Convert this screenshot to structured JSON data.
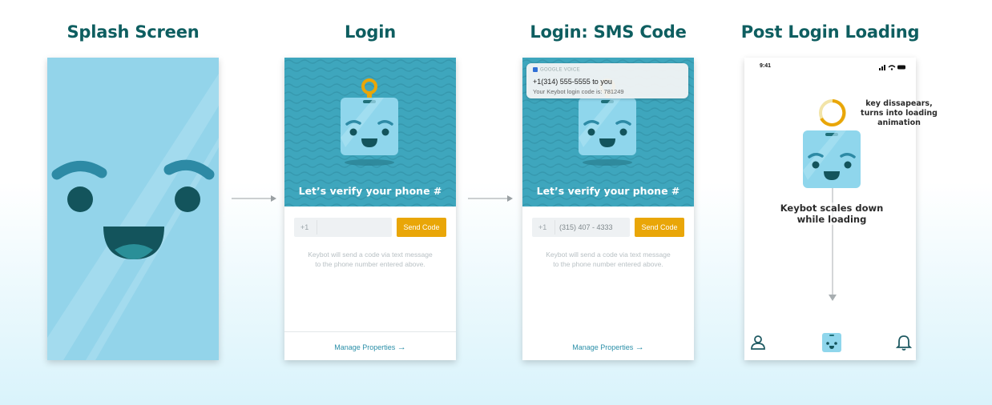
{
  "columns": {
    "splash": "Splash Screen",
    "login": "Login",
    "sms": "Login: SMS Code",
    "post": "Post Login Loading"
  },
  "login": {
    "hero_title": "Let’s verify your phone #",
    "country_code": "+1",
    "phone_value": "",
    "send_label": "Send Code",
    "hint_line1": "Keybot will send a code via text message",
    "hint_line2": "to the phone number entered above.",
    "manage_label": "Manage Properties"
  },
  "sms": {
    "hero_title": "Let’s verify your phone #",
    "country_code": "+1",
    "phone_value": "(315) 407 - 4333",
    "send_label": "Send Code",
    "hint_line1": "Keybot will send a code via text message",
    "hint_line2": "to the phone number entered above.",
    "manage_label": "Manage Properties",
    "notification": {
      "app": "GOOGLE VOICE",
      "from": "+1(314) 555-5555 to you",
      "message": "Your Keybot login code is: 781249"
    }
  },
  "post": {
    "status_time": "9:41",
    "annotation_key_line1": "key dissapears,",
    "annotation_key_line2": "turns into loading",
    "annotation_key_line3": "animation",
    "annotation_scale_line1": "Keybot scales down",
    "annotation_scale_line2": "while loading",
    "nav": [
      "profile-icon",
      "keybot-home-icon",
      "bell-icon"
    ]
  },
  "colors": {
    "title": "#0e5e60",
    "splash_bg": "#93d4ea",
    "hero_bg": "#3ea6bd",
    "accent": "#e9a608",
    "robot": "#8fd6ec",
    "robot_dark": "#1f7079",
    "link": "#2b8fa8"
  }
}
